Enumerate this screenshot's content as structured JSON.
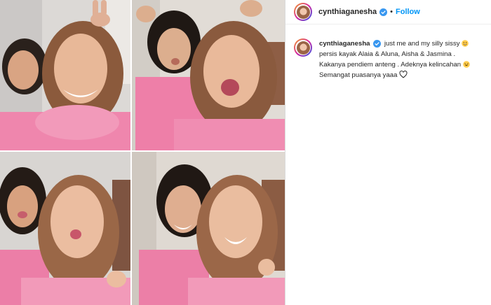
{
  "post": {
    "username": "cynthiaganesha",
    "separator": "•",
    "follow_label": "Follow",
    "caption_lines": [
      "just me and my silly sissy",
      "persis kayak Alaia & Aluna, Aisha & Jasmina .",
      "Kakanya pendiem anteng . Adeknya kelincahan",
      "Semangat puasanya yaaa"
    ]
  },
  "photos": [
    {
      "name": "photo-two-women-selfie-smiling"
    },
    {
      "name": "photo-two-women-selfie-wink"
    },
    {
      "name": "photo-two-women-selfie-kiss"
    },
    {
      "name": "photo-two-women-selfie-laughing"
    }
  ],
  "colors": {
    "accent": "#0095f6",
    "verified": "#3897f0",
    "pink_top": "#ef86ad",
    "text": "#262626"
  },
  "icons": {
    "verified": "verified-badge-icon",
    "emoji": "emoji-icon",
    "heart": "heart-outline-icon"
  }
}
